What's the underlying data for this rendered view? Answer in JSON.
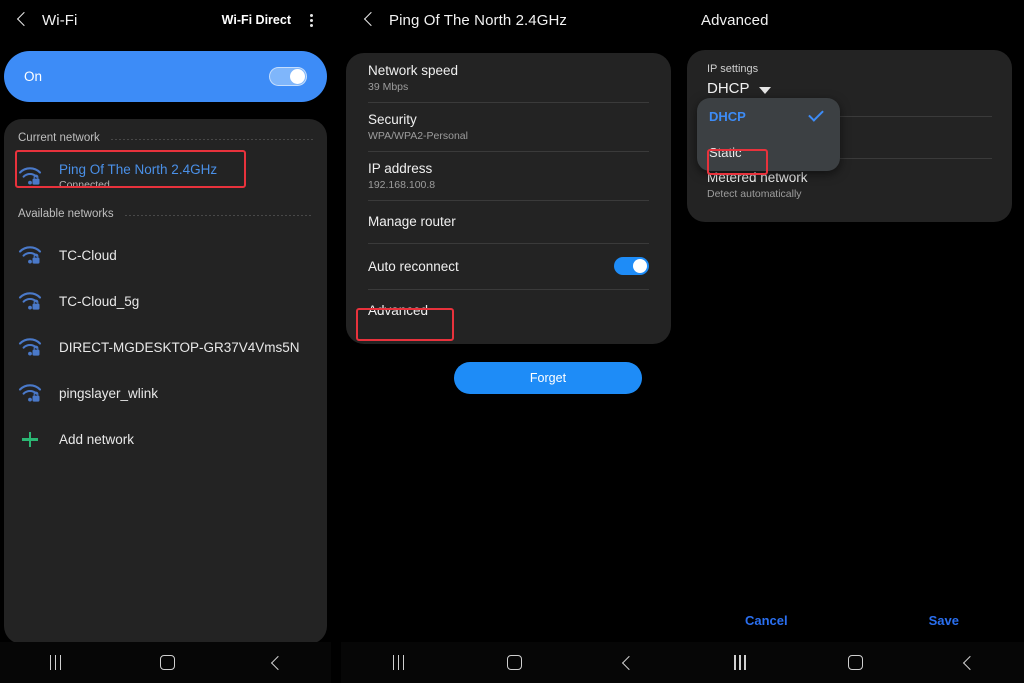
{
  "theme": {
    "background": "#000000",
    "card": "#232323",
    "accent_blue": "#1e8cf7",
    "banner_blue": "#3d8cf7",
    "link_blue": "#4a90e8",
    "highlight_red": "#e8323c",
    "add_green": "#2bb673",
    "dropdown_bg": "#3c4043"
  },
  "panel_wifi": {
    "appbar": {
      "back_label": "Back",
      "title": "Wi-Fi",
      "action_label": "Wi-Fi Direct",
      "menu_label": "More options"
    },
    "toggle_banner": {
      "label": "On",
      "state": "on"
    },
    "current_network_section": {
      "header": "Current network",
      "item": {
        "name": "Ping Of The North 2.4GHz",
        "status": "Connected",
        "icon": "wifi-lock-icon",
        "highlighted": true
      }
    },
    "available_networks_section": {
      "header": "Available networks",
      "items": [
        {
          "name": "TC-Cloud",
          "icon": "wifi-lock-icon"
        },
        {
          "name": "TC-Cloud_5g",
          "icon": "wifi-lock-icon"
        },
        {
          "name": "DIRECT-MGDESKTOP-GR37V4Vms5N",
          "icon": "wifi-lock-icon"
        },
        {
          "name": "pingslayer_wlink",
          "icon": "wifi-lock-icon"
        }
      ],
      "add_network": {
        "name": "Add network",
        "icon": "plus-icon"
      }
    },
    "navbar": {
      "recents": "Recents",
      "home": "Home",
      "back": "Back"
    }
  },
  "panel_details": {
    "appbar": {
      "back_label": "Back",
      "title": "Ping Of The North 2.4GHz"
    },
    "rows": [
      {
        "title": "Network speed",
        "sub": "39 Mbps"
      },
      {
        "title": "Security",
        "sub": "WPA/WPA2-Personal"
      },
      {
        "title": "IP address",
        "sub": "192.168.100.8"
      },
      {
        "title": "Manage router",
        "sub": ""
      },
      {
        "title": "Auto reconnect",
        "sub": "",
        "switch": "on"
      },
      {
        "title": "Advanced",
        "sub": "",
        "highlighted": true
      }
    ],
    "forget_button": "Forget",
    "navbar": {
      "recents": "Recents",
      "home": "Home",
      "back": "Back"
    }
  },
  "panel_advanced": {
    "appbar": {
      "title": "Advanced"
    },
    "ip_settings": {
      "label": "IP settings",
      "value": "DHCP",
      "caret": "chevron-down-icon"
    },
    "dropdown": {
      "options": [
        {
          "label": "DHCP",
          "selected": true
        },
        {
          "label": "Static",
          "selected": false,
          "highlighted": true
        }
      ]
    },
    "rows": [
      {
        "title": "",
        "sub": ""
      },
      {
        "title": "Metered network",
        "sub": "Detect automatically"
      }
    ],
    "footer": {
      "cancel": "Cancel",
      "save": "Save"
    },
    "navbar": {
      "recents": "Recents",
      "home": "Home",
      "back": "Back"
    }
  }
}
